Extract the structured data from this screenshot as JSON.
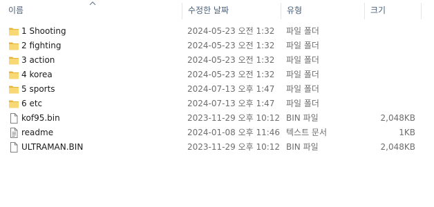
{
  "columns": {
    "name": "이름",
    "date": "수정한 날짜",
    "type": "유형",
    "size": "크기"
  },
  "rows": [
    {
      "name": "1 Shooting",
      "date": "2024-05-23 오전 1:32",
      "type": "파일 폴더",
      "size": "",
      "icon": "folder-icon"
    },
    {
      "name": "2 fighting",
      "date": "2024-05-23 오전 1:32",
      "type": "파일 폴더",
      "size": "",
      "icon": "folder-icon"
    },
    {
      "name": "3 action",
      "date": "2024-05-23 오전 1:32",
      "type": "파일 폴더",
      "size": "",
      "icon": "folder-icon"
    },
    {
      "name": "4 korea",
      "date": "2024-05-23 오전 1:32",
      "type": "파일 폴더",
      "size": "",
      "icon": "folder-icon"
    },
    {
      "name": "5 sports",
      "date": "2024-07-13 오후 1:47",
      "type": "파일 폴더",
      "size": "",
      "icon": "folder-icon"
    },
    {
      "name": "6 etc",
      "date": "2024-07-13 오후 1:47",
      "type": "파일 폴더",
      "size": "",
      "icon": "folder-icon"
    },
    {
      "name": "kof95.bin",
      "date": "2023-11-29 오후 10:12",
      "type": "BIN 파일",
      "size": "2,048KB",
      "icon": "file-icon"
    },
    {
      "name": "readme",
      "date": "2024-01-08 오후 11:46",
      "type": "텍스트 문서",
      "size": "1KB",
      "icon": "text-document-icon"
    },
    {
      "name": "ULTRAMAN.BIN",
      "date": "2023-11-29 오후 10:12",
      "type": "BIN 파일",
      "size": "2,048KB",
      "icon": "file-icon"
    }
  ],
  "colors": {
    "header_text": "#4c607a",
    "folder": "#f8d775",
    "secondary_text": "#6d6d6d"
  }
}
